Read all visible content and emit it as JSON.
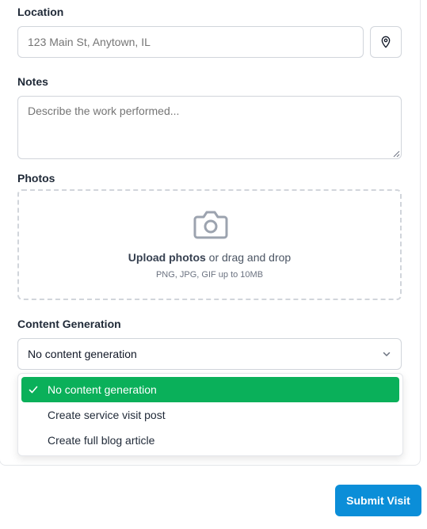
{
  "location": {
    "label": "Location",
    "placeholder": "123 Main St, Anytown, IL",
    "locate_icon": "map-pin-icon"
  },
  "notes": {
    "label": "Notes",
    "placeholder": "Describe the work performed..."
  },
  "photos": {
    "label": "Photos",
    "icon": "camera-icon",
    "upload_strong": "Upload photos",
    "upload_rest": " or drag and drop",
    "hint": "PNG, JPG, GIF up to 10MB"
  },
  "content_generation": {
    "label": "Content Generation",
    "selected": "No content generation",
    "options": [
      {
        "label": "No content generation",
        "selected": true
      },
      {
        "label": "Create service visit post",
        "selected": false
      },
      {
        "label": "Create full blog article",
        "selected": false
      }
    ],
    "selected_color": "#0ab05a"
  },
  "submit_label": "Submit Visit",
  "colors": {
    "primary": "#0b8ed8",
    "border": "#d1d5db"
  }
}
